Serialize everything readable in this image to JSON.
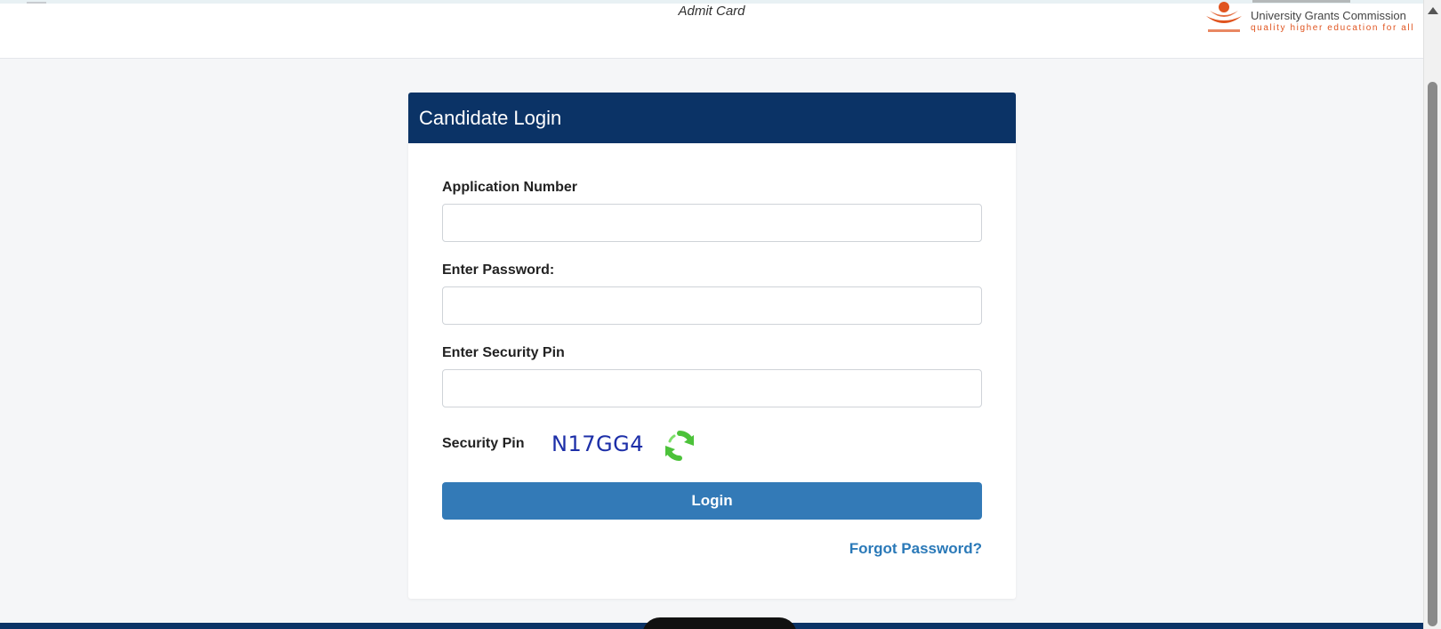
{
  "header": {
    "title": "Admit Card",
    "logo": {
      "name": "University Grants Commission",
      "tagline": "quality higher education for all"
    }
  },
  "login_card": {
    "title": "Candidate Login",
    "fields": [
      {
        "label": "Application Number",
        "value": ""
      },
      {
        "label": "Enter Password:",
        "value": ""
      },
      {
        "label": "Enter Security Pin",
        "value": ""
      }
    ],
    "security_pin": {
      "label": "Security Pin",
      "value": "N17GG4",
      "refresh_icon": "refresh-icon"
    },
    "login_label": "Login",
    "forgot_label": "Forgot Password?"
  },
  "colors": {
    "header_blue": "#0b3366",
    "button_blue": "#337ab7",
    "link_blue": "#2a79b8",
    "pin_blue": "#1d2fa8",
    "refresh_green": "#4cc23a",
    "ugc_orange": "#e0541f"
  }
}
